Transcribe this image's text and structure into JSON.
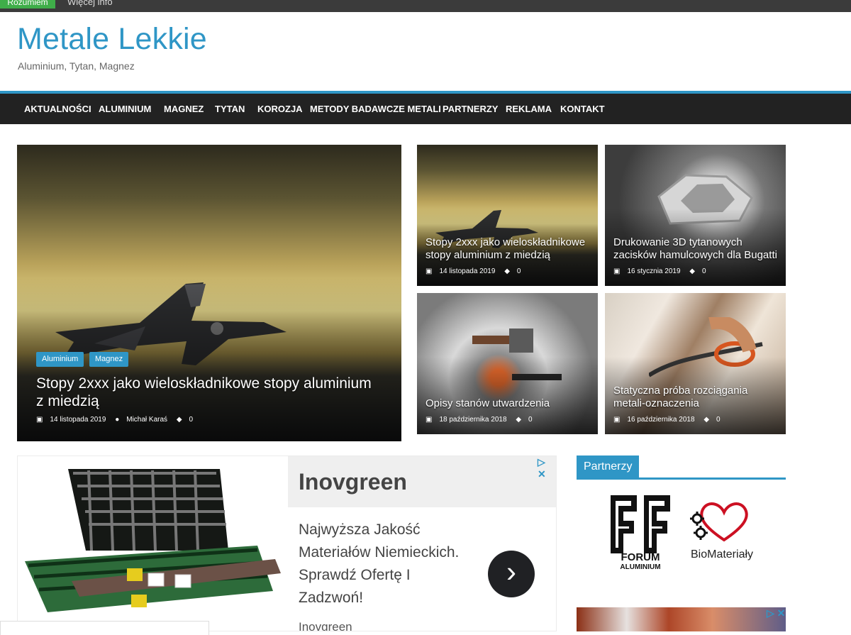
{
  "cookie": {
    "accept": "Rozumiem",
    "more": "Więcej info"
  },
  "site": {
    "title": "Metale Lekkie",
    "description": "Aluminium, Tytan, Magnez"
  },
  "nav": [
    "AKTUALNOŚCI",
    "ALUMINIUM",
    "MAGNEZ",
    "TYTAN",
    "KOROZJA",
    "METODY BADAWCZE METALI",
    "PARTNERZY",
    "REKLAMA",
    "KONTAKT"
  ],
  "featured": {
    "tags": [
      "Aluminium",
      "Magnez"
    ],
    "title": "Stopy 2xxx jako wieloskładnikowe stopy aluminium z miedzią",
    "date": "14 listopada 2019",
    "author": "Michał Karaś",
    "comments": "0"
  },
  "cards": [
    {
      "title": "Stopy 2xxx jako wieloskładnikowe stopy aluminium z miedzią",
      "date": "14 listopada 2019",
      "comments": "0"
    },
    {
      "title": "Drukowanie 3D tytanowych zacisków hamulcowych dla Bugatti",
      "date": "16 stycznia 2019",
      "comments": "0"
    },
    {
      "title": "Opisy stanów utwardzenia",
      "date": "18 października 2018",
      "comments": "0"
    },
    {
      "title": "Statyczna próba rozciągania metali-oznaczenia",
      "date": "16 października 2018",
      "comments": "0"
    }
  ],
  "ad": {
    "brand": "Inovgreen",
    "copy": "Najwyższa Jakość Materiałów Niemieckich. Sprawdź Ofertę I Zadzwoń!",
    "footer": "Inovgreen",
    "choices": "▷ ✕"
  },
  "sidebar": {
    "title": "Partnerzy",
    "forum_top": "FA",
    "forum_word": "FORUM",
    "forum_sub": "ALUMINIUM",
    "bio_label": "BioMateriały"
  },
  "icons": {
    "calendar": "calendar-icon",
    "user": "user-icon",
    "comment": "comment-icon",
    "arrow": "chevron-right-icon"
  },
  "colors": {
    "accent": "#2f96c6",
    "nav": "#222222",
    "cookie": "#3fae49"
  }
}
